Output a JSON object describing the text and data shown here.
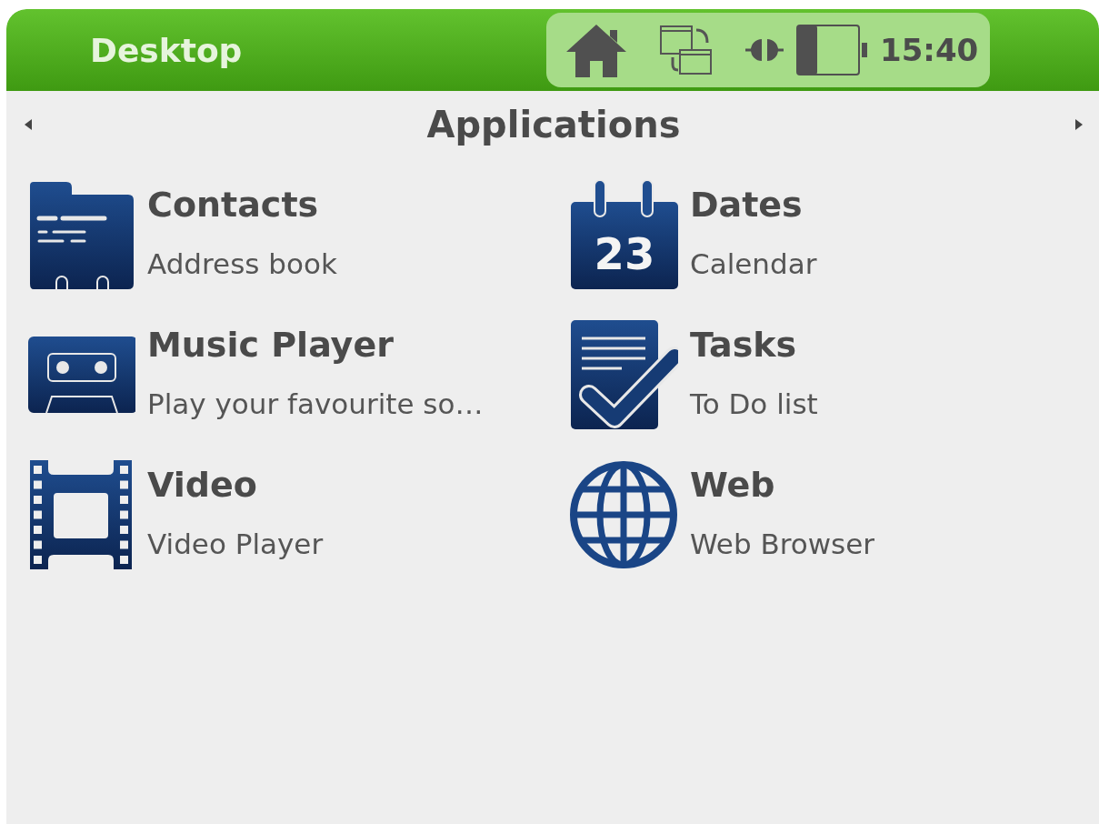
{
  "top_bar": {
    "title": "Desktop",
    "time": "15:40"
  },
  "heading": "Applications",
  "apps": [
    {
      "kind": "contacts",
      "title": "Contacts",
      "subtitle": "Address book"
    },
    {
      "kind": "calendar",
      "title": "Dates",
      "subtitle": "Calendar",
      "icon_text": "23"
    },
    {
      "kind": "cassette",
      "title": "Music Player",
      "subtitle": "Play your favourite so…"
    },
    {
      "kind": "tasks",
      "title": "Tasks",
      "subtitle": "To Do list"
    },
    {
      "kind": "film",
      "title": "Video",
      "subtitle": "Video Player"
    },
    {
      "kind": "globe",
      "title": "Web",
      "subtitle": "Web Browser"
    }
  ]
}
